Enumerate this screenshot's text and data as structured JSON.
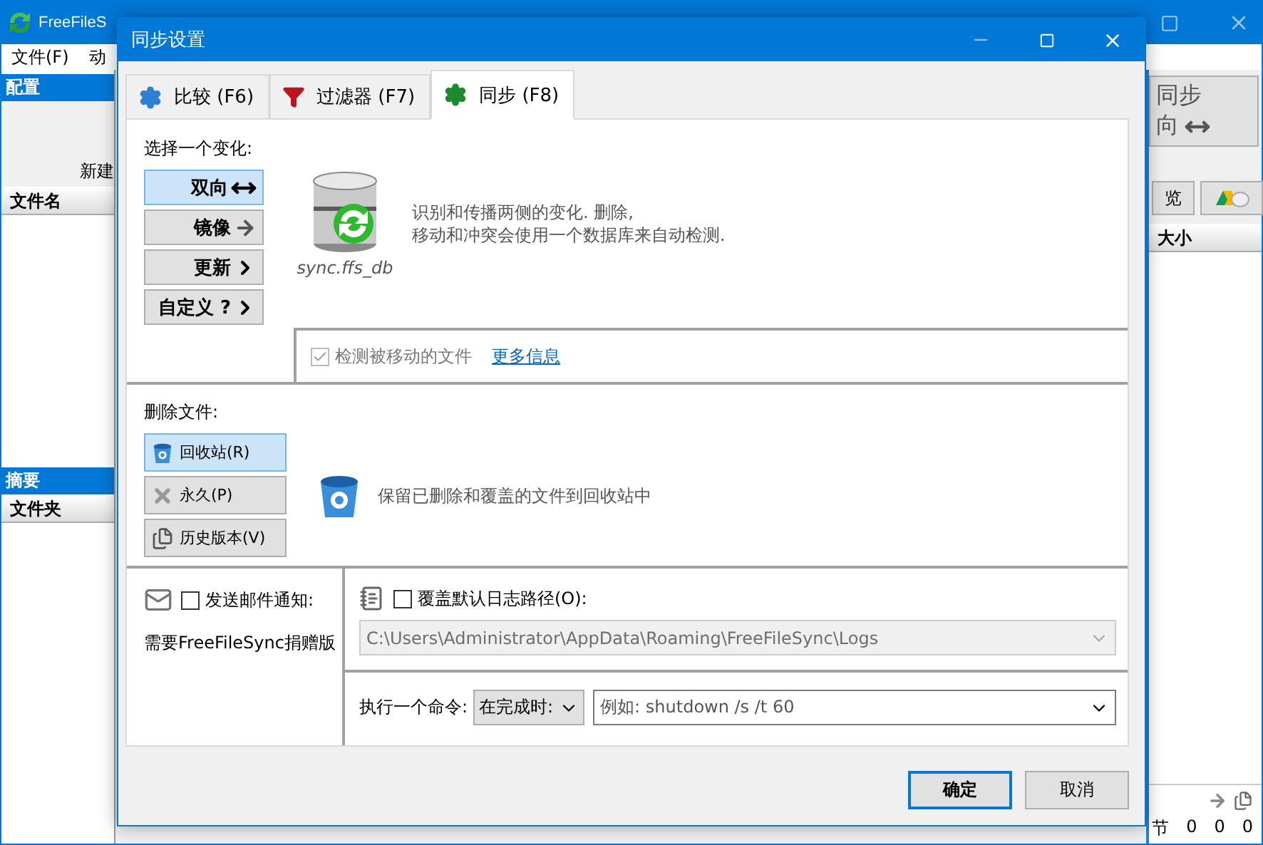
{
  "main_window": {
    "title": "FreeFileS",
    "menu": [
      "文件(F)",
      "动"
    ],
    "left_panel": {
      "config_header": "配置",
      "new_button": "新建",
      "column": "文件名",
      "summary_header": "摘要",
      "summary_column": "文件夹"
    },
    "right_panel": {
      "sync_button": {
        "line_1": "同步",
        "line_2": "向"
      },
      "view_button": "览",
      "size_column": "大小",
      "status_label": "节",
      "counts": [
        "0",
        "0",
        "0"
      ]
    }
  },
  "dialog": {
    "title": "同步设置",
    "tabs": [
      {
        "label": "比较 (F6)",
        "selected": false
      },
      {
        "label": "过滤器 (F7)",
        "selected": false
      },
      {
        "label": "同步 (F8)",
        "selected": true
      }
    ],
    "variant": {
      "label": "选择一个变化:",
      "options": [
        {
          "label": "双向",
          "selected": true
        },
        {
          "label": "镜像",
          "selected": false
        },
        {
          "label": "更新",
          "selected": false
        },
        {
          "label": "自定义 ?",
          "selected": false
        }
      ],
      "db_caption": "sync.ffs_db",
      "description": [
        "识别和传播两侧的变化. 删除,",
        "移动和冲突会使用一个数据库来自动检测."
      ],
      "detect_moved": {
        "label": "检测被移动的文件",
        "checked": true,
        "disabled": true
      },
      "more_info": "更多信息"
    },
    "deletion": {
      "label": "删除文件:",
      "options": [
        {
          "label": "回收站(R)",
          "selected": true
        },
        {
          "label": "永久(P)",
          "selected": false
        },
        {
          "label": "历史版本(V)",
          "selected": false
        }
      ],
      "description": "保留已删除和覆盖的文件到回收站中"
    },
    "email": {
      "label": "发送邮件通知:",
      "checked": false,
      "note": "需要FreeFileSync捐赠版"
    },
    "log": {
      "label": "覆盖默认日志路径(O):",
      "checked": false,
      "path": "C:\\Users\\Administrator\\AppData\\Roaming\\FreeFileSync\\Logs",
      "disabled": true
    },
    "command": {
      "label": "执行一个命令:",
      "trigger": "在完成时:",
      "placeholder": "例如: shutdown /s /t 60"
    },
    "buttons": [
      {
        "label": "确定",
        "default": true
      },
      {
        "label": "取消",
        "default": false
      }
    ]
  }
}
